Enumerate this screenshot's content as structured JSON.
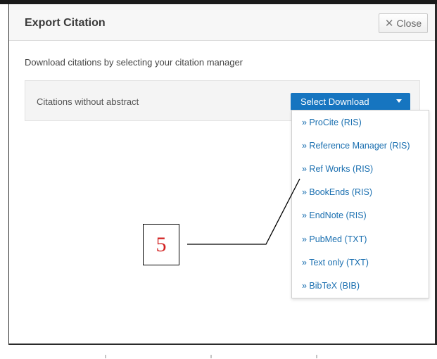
{
  "dialog": {
    "title": "Export Citation",
    "close_label": "Close",
    "instructions": "Download citations by selecting your citation manager",
    "row_label": "Citations without abstract",
    "select_label": "Select Download",
    "menu_items": [
      "» ProCite (RIS)",
      "» Reference Manager (RIS)",
      "» Ref Works (RIS)",
      "» BookEnds (RIS)",
      "» EndNote (RIS)",
      "» PubMed (TXT)",
      "» Text only (TXT)",
      "» BibTeX (BIB)"
    ]
  },
  "annotation": {
    "label": "5"
  },
  "colors": {
    "accent": "#1675c0",
    "link": "#1a6fb0",
    "annotation": "#d22020"
  }
}
